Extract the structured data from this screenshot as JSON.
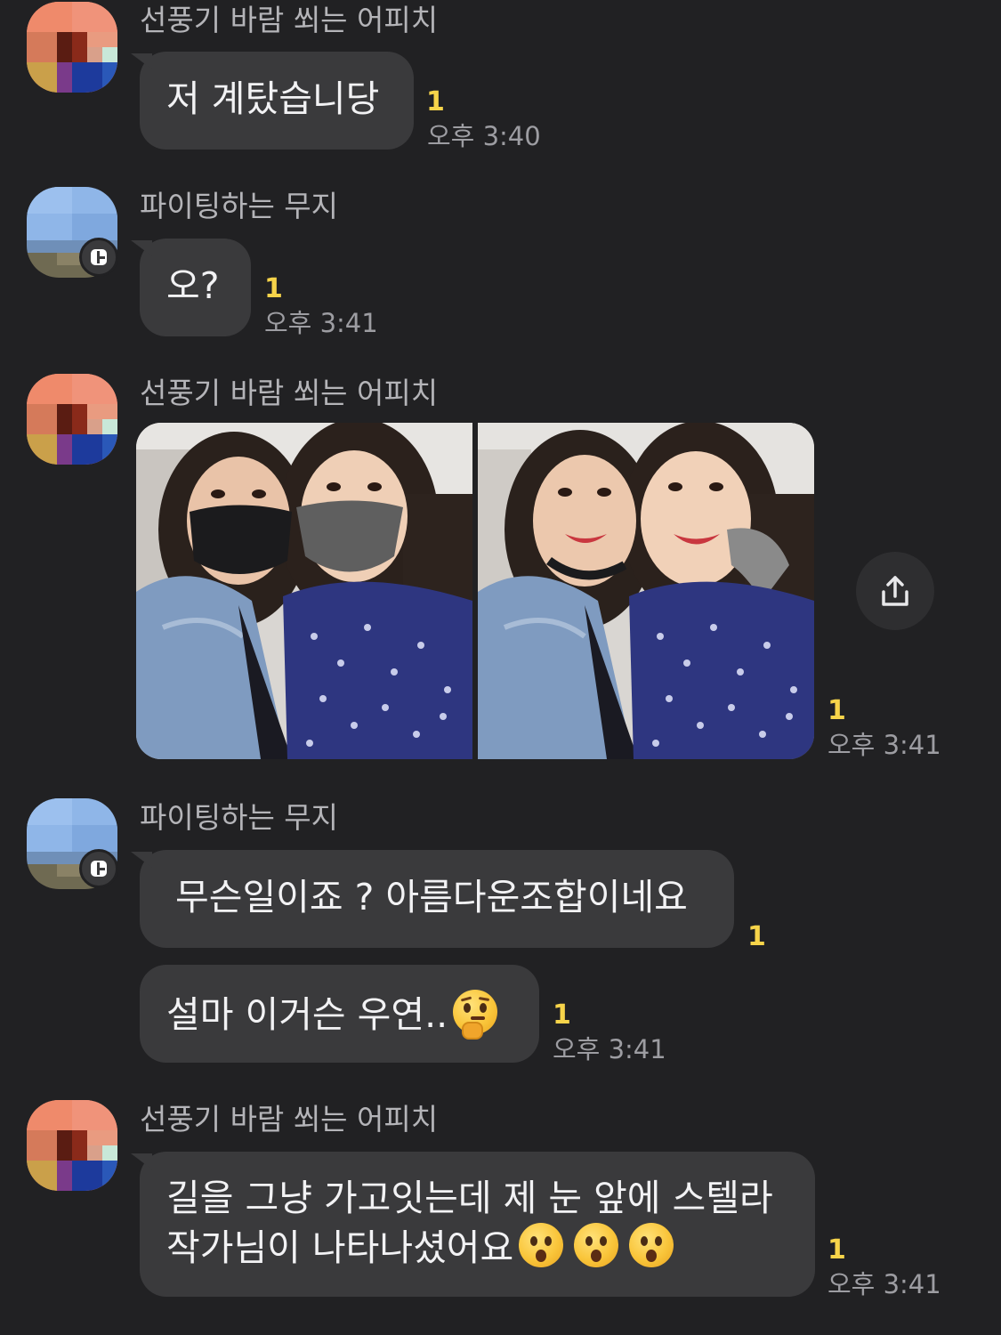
{
  "messages": [
    {
      "sender": "선풍기 바람 쐬는 어피치",
      "bubbles": [
        {
          "text": "저 계탔습니당",
          "unread": "1",
          "time": "오후 3:40"
        }
      ]
    },
    {
      "sender": "파이팅하는 무지",
      "bubbles": [
        {
          "text": "오?",
          "unread": "1",
          "time": "오후 3:41"
        }
      ]
    },
    {
      "sender": "선풍기 바람 쐬는 어피치",
      "photos": {
        "unread": "1",
        "time": "오후 3:41",
        "share_icon": "share-icon"
      }
    },
    {
      "sender": "파이팅하는 무지",
      "bubbles": [
        {
          "text": "무슨일이죠 ? 아름다운조합이네요",
          "unread": "1",
          "time": ""
        },
        {
          "text": "설마 이거슨 우연..",
          "emoji": "thinking-face",
          "unread": "1",
          "time": "오후 3:41"
        }
      ]
    },
    {
      "sender": "선풍기 바람 쐬는 어피치",
      "bubbles": [
        {
          "line1": "길을 그냥 가고잇는데 제 눈 앞에 스텔라",
          "line2": "작가님이 나타나셨어요",
          "emoji": "hushed-face",
          "unread": "1",
          "time": "오후 3:41"
        }
      ]
    }
  ],
  "colors": {
    "background": "#212123",
    "bubble": "#3a3a3c",
    "text": "#f2f2f4",
    "sender": "#b4b4b8",
    "unread": "#f7d44a",
    "time": "#9d9da2"
  }
}
